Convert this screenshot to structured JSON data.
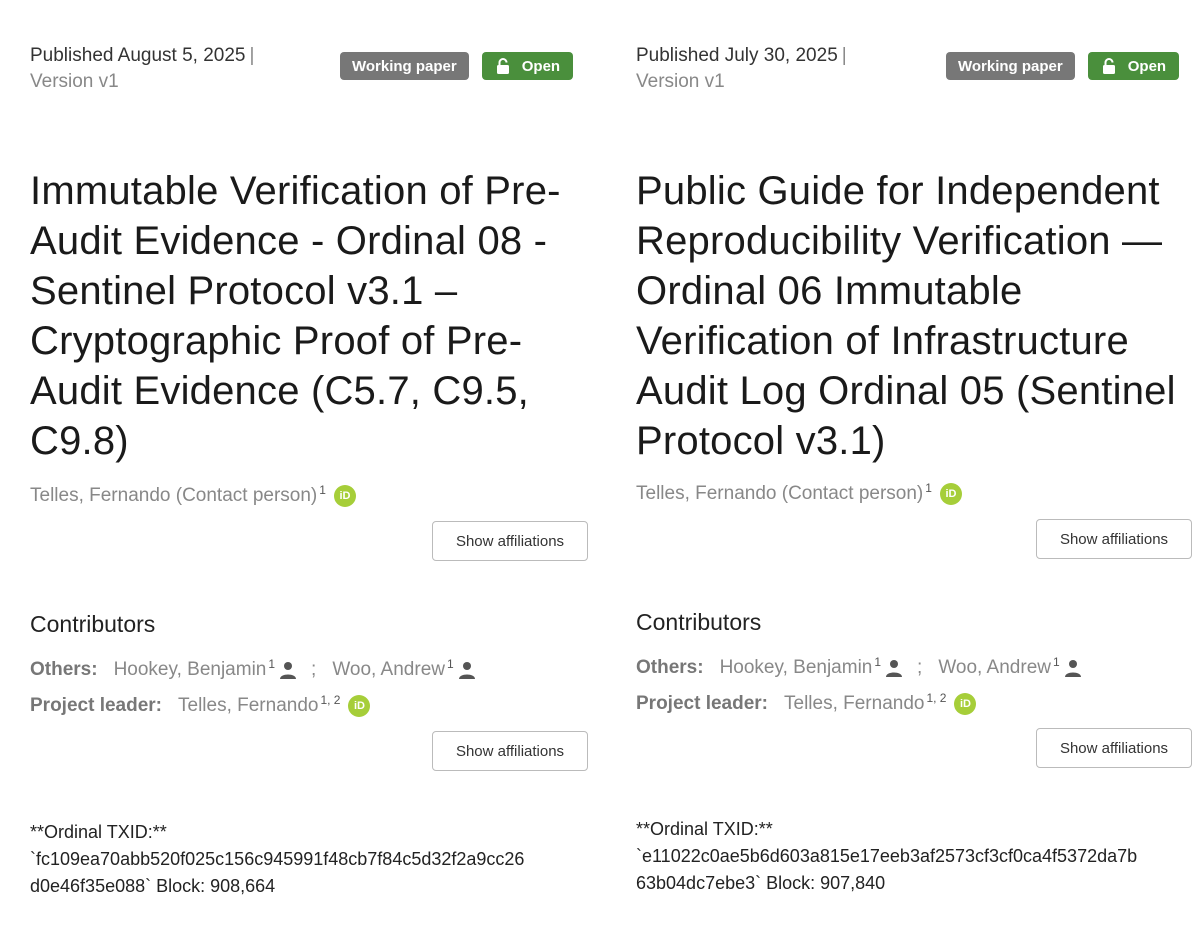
{
  "colors": {
    "badge_gray": "#777777",
    "badge_green": "#4a8f3c",
    "orcid_green": "#a6ce39"
  },
  "icons": {
    "lock": "lock-open-icon",
    "orcid": "orcid-icon",
    "person": "person-icon"
  },
  "records": [
    {
      "published": "Published August 5, 2025",
      "separator": "|",
      "version": "Version v1",
      "badge_type": "Working paper",
      "badge_access": "Open",
      "title": "Immutable Verification of Pre-Audit Evidence - Ordinal 08 - Sentinel Protocol v3.1 – Cryptographic Proof of Pre-Audit Evidence (C5.7, C9.5, C9.8)",
      "creator": {
        "name": "Telles, Fernando (Contact person)",
        "sup": "1",
        "orcid_label": "iD"
      },
      "show_affiliations": "Show affiliations",
      "contributors_heading": "Contributors",
      "others_label": "Others:",
      "others": [
        {
          "name": "Hookey, Benjamin",
          "sup": "1"
        },
        {
          "name": "Woo, Andrew",
          "sup": "1"
        }
      ],
      "others_separator": ";",
      "leader_label": "Project leader:",
      "leader": {
        "name": "Telles, Fernando",
        "sup": "1, 2",
        "orcid_label": "iD"
      },
      "txid_line1": "**Ordinal TXID:**",
      "txid_line2": "`fc109ea70abb520f025c156c945991f48cb7f84c5d32f2a9cc26",
      "txid_line3": "d0e46f35e088` Block: 908,664"
    },
    {
      "published": "Published July 30, 2025",
      "separator": "|",
      "version": "Version v1",
      "badge_type": "Working paper",
      "badge_access": "Open",
      "title": "Public Guide for Independent Reproducibility Verification — Ordinal 06 Immutable Verification of Infrastructure Audit Log Ordinal 05 (Sentinel Protocol v3.1)",
      "creator": {
        "name": "Telles, Fernando (Contact person)",
        "sup": "1",
        "orcid_label": "iD"
      },
      "show_affiliations": "Show affiliations",
      "contributors_heading": "Contributors",
      "others_label": "Others:",
      "others": [
        {
          "name": "Hookey, Benjamin",
          "sup": "1"
        },
        {
          "name": "Woo, Andrew",
          "sup": "1"
        }
      ],
      "others_separator": ";",
      "leader_label": "Project leader:",
      "leader": {
        "name": "Telles, Fernando",
        "sup": "1, 2",
        "orcid_label": "iD"
      },
      "txid_line1": "**Ordinal TXID:**",
      "txid_line2": "`e11022c0ae5b6d603a815e17eeb3af2573cf3cf0ca4f5372da7b",
      "txid_line3": "63b04dc7ebe3` Block: 907,840"
    }
  ]
}
